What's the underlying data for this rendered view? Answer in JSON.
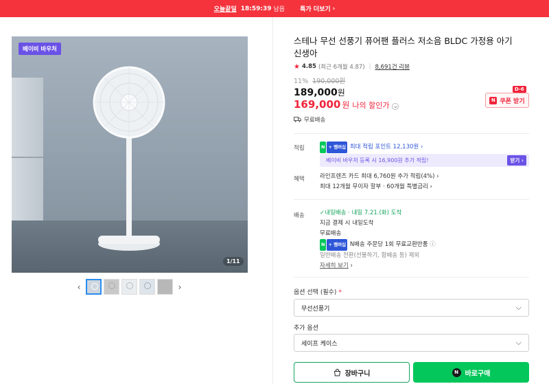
{
  "topbar": {
    "brand": "오늘끝딜",
    "timer": "18:59:39",
    "timer_suffix": "남음",
    "more": "특가 더보기"
  },
  "gallery": {
    "badge": "베이비 바우처",
    "counter": "1/11",
    "thumb_count": 5
  },
  "product": {
    "title": "스테나 무선 선풍기 퓨어팬 플러스 저소음 BLDC 가정용 아기 신생아",
    "rating": "4.85",
    "rating_sub": "(최근 6개월 4.87)",
    "reviews": "8,691건 리뷰",
    "discount_pct": "11%",
    "original_price": "190,000원",
    "price": "189,000",
    "price_unit": "원",
    "my_price": "169,000",
    "my_price_unit": "원",
    "my_price_label": "나의 할인가",
    "shipping_note": "무료배송",
    "coupon_label": "쿠폰 받기",
    "coupon_dday": "D-6"
  },
  "points": {
    "label": "적립",
    "max_point": "최대 적립 포인트 12,130원",
    "voucher_text": "베이비 바우처 등록 시 16,900원 추가 적립!",
    "voucher_btn": "받기"
  },
  "benefits": {
    "label": "혜택",
    "line1": "라인프렌즈 카드 최대 6,760원 추가 적립(4%)",
    "line2": "최대 12개월 무이자 할부 · 60개월 특별금리"
  },
  "delivery": {
    "label": "배송",
    "fast_tag": "내일배송",
    "arrival": "· 내일 7.21.(화) 도착",
    "line2": "지금 결제 시 내일도착",
    "line3": "무료배송",
    "line4": "N배송 주문당 1회 무료교환반품",
    "line5": "일반배송 전환(선물하기, 합배송 등) 제외",
    "details": "자세히 보기"
  },
  "options": {
    "required_label": "옵션 선택 (필수)",
    "required_value": "무선선풍기",
    "extra_label": "추가 옵션",
    "extra_value": "세이프 케이스"
  },
  "actions": {
    "cart": "장바구니",
    "buy": "바로구매"
  },
  "colors": {
    "accent_red": "#f0243a",
    "naver_green": "#03c75a",
    "voucher_purple": "#6b52e6"
  }
}
